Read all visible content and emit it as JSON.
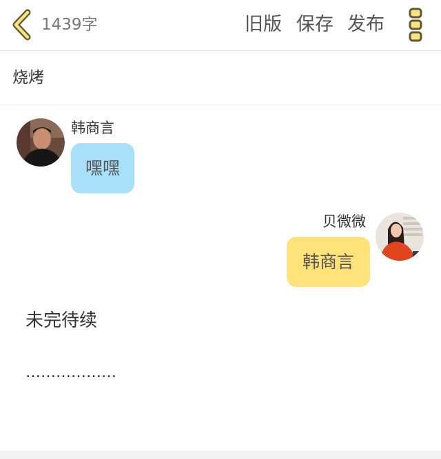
{
  "toolbar": {
    "word_count": "1439字",
    "old_version": "旧版",
    "save": "保存",
    "publish": "发布",
    "back_icon": "chevron-left-icon",
    "more_icon": "more-vertical-icon",
    "accent_color": "#ffe27a"
  },
  "title": "烧烤",
  "messages": [
    {
      "side": "left",
      "sender": "韩商言",
      "text": "嘿嘿",
      "bubble_color": "#a8dff9"
    },
    {
      "side": "right",
      "sender": "贝微微",
      "text": "韩商言",
      "bubble_color": "#ffe27a"
    }
  ],
  "body": {
    "to_be_continued": "未完待续",
    "ellipsis": "………………"
  }
}
